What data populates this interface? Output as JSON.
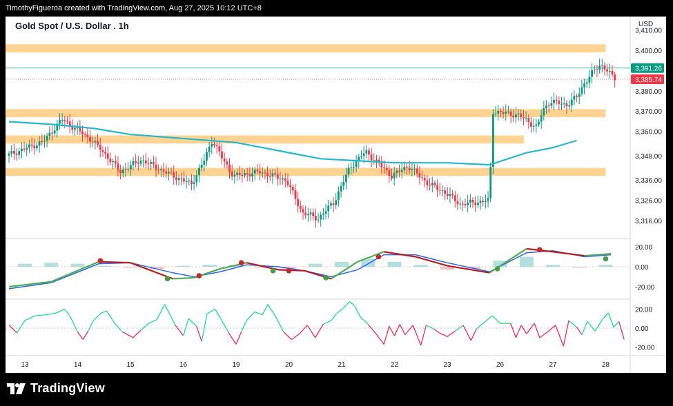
{
  "header": {
    "text": "TimothyFigueroa created with TradingView.com, Aug 27, 2025 10:12 UTC+8"
  },
  "footer": {
    "brand": "TradingView"
  },
  "colors": {
    "up": "#089981",
    "down": "#f23645",
    "zone": "#ffcc80",
    "ema": "#22b8cf",
    "lastPriceLine": "#089981",
    "prevCloseLine": "#f23645"
  },
  "chart_data": {
    "type": "candlestick",
    "title": "Gold Spot / U.S. Dollar . 1h",
    "currency": "USD",
    "x_labels": [
      "13",
      "14",
      "15",
      "16",
      "19",
      "20",
      "21",
      "22",
      "23",
      "26",
      "27",
      "28"
    ],
    "price_axis": {
      "ticks": [
        3316,
        3326,
        3336,
        3348,
        3360,
        3370,
        3380,
        3400,
        3410
      ],
      "tick_labels": [
        "3,316.00",
        "3,326.00",
        "3,336.00",
        "3,348.00",
        "3,360.00",
        "3,370.00",
        "3,380.00",
        "3,400.00",
        "3,410.00"
      ]
    },
    "last_price": {
      "value": 3391.26,
      "label": "3,391.26"
    },
    "prev_close": {
      "value": 3385.74,
      "label": "3,385.74"
    },
    "zones": [
      {
        "low": 3399,
        "high": 3403,
        "from_day": 0,
        "to_day": 11
      },
      {
        "low": 3367,
        "high": 3371,
        "from_day": 0,
        "to_day": 11
      },
      {
        "low": 3354,
        "high": 3358,
        "from_day": 0,
        "to_day": 9.45
      },
      {
        "low": 3338,
        "high": 3342,
        "from_day": 0,
        "to_day": 11
      }
    ],
    "ema": [
      [
        -0.3,
        3364.8
      ],
      [
        0.5,
        3363.5
      ],
      [
        1.3,
        3361.5
      ],
      [
        2.0,
        3358.5
      ],
      [
        3.0,
        3356.5
      ],
      [
        4.0,
        3354.5
      ],
      [
        5.0,
        3349.5
      ],
      [
        5.6,
        3346.5
      ],
      [
        6.3,
        3345.5
      ],
      [
        7.0,
        3344.5
      ],
      [
        8.0,
        3344.5
      ],
      [
        8.8,
        3343.5
      ],
      [
        9.5,
        3349.5
      ],
      [
        10.0,
        3352
      ],
      [
        10.45,
        3355.5
      ]
    ],
    "price_path": [
      [
        -0.3,
        3348
      ],
      [
        0.4,
        3355
      ],
      [
        0.75,
        3366
      ],
      [
        1.3,
        3356
      ],
      [
        1.6,
        3348
      ],
      [
        1.85,
        3340
      ],
      [
        2.25,
        3346
      ],
      [
        2.7,
        3340
      ],
      [
        3.2,
        3334
      ],
      [
        3.45,
        3346
      ],
      [
        3.6,
        3356
      ],
      [
        3.8,
        3346
      ],
      [
        4.0,
        3338
      ],
      [
        4.5,
        3340
      ],
      [
        5.0,
        3336
      ],
      [
        5.3,
        3320
      ],
      [
        5.6,
        3317
      ],
      [
        5.9,
        3325
      ],
      [
        6.2,
        3342
      ],
      [
        6.5,
        3350
      ],
      [
        7.0,
        3338
      ],
      [
        7.3,
        3343
      ],
      [
        7.7,
        3334
      ],
      [
        8.0,
        3330
      ],
      [
        8.3,
        3324
      ],
      [
        8.85,
        3326
      ],
      [
        8.9,
        3370
      ],
      [
        9.4,
        3368
      ],
      [
        9.75,
        3362
      ],
      [
        9.85,
        3370
      ],
      [
        10.0,
        3375
      ],
      [
        10.3,
        3373
      ],
      [
        10.5,
        3377
      ],
      [
        10.65,
        3384
      ],
      [
        10.8,
        3389
      ],
      [
        10.95,
        3393
      ],
      [
        11.05,
        3391
      ],
      [
        11.2,
        3386
      ]
    ],
    "macd": {
      "axis_labels": [
        "20.00",
        "0.00",
        "-20.00"
      ],
      "axis_values": [
        20,
        0,
        -20
      ],
      "macd_line": [
        [
          -0.3,
          -20
        ],
        [
          0.5,
          -15
        ],
        [
          1.4,
          5
        ],
        [
          2.0,
          4
        ],
        [
          2.8,
          -12
        ],
        [
          3.2,
          -11
        ],
        [
          3.7,
          -2
        ],
        [
          4.2,
          4
        ],
        [
          4.8,
          -3
        ],
        [
          5.3,
          -4
        ],
        [
          5.8,
          -12
        ],
        [
          6.3,
          5
        ],
        [
          6.8,
          15
        ],
        [
          7.4,
          10
        ],
        [
          8.0,
          1
        ],
        [
          8.8,
          -6
        ],
        [
          9.5,
          18
        ],
        [
          10.0,
          15
        ],
        [
          10.6,
          11
        ],
        [
          11.1,
          13
        ]
      ],
      "signal_line": [
        [
          -0.3,
          -22
        ],
        [
          0.5,
          -16
        ],
        [
          1.4,
          3
        ],
        [
          2.0,
          4
        ],
        [
          2.8,
          -6
        ],
        [
          3.2,
          -10
        ],
        [
          3.7,
          -5
        ],
        [
          4.2,
          2
        ],
        [
          4.8,
          0
        ],
        [
          5.3,
          -4
        ],
        [
          5.8,
          -10
        ],
        [
          6.3,
          -3
        ],
        [
          6.8,
          12
        ],
        [
          7.4,
          12
        ],
        [
          8.0,
          4
        ],
        [
          8.8,
          -5
        ],
        [
          9.5,
          14
        ],
        [
          10.0,
          16
        ],
        [
          10.6,
          10
        ],
        [
          11.1,
          12
        ]
      ],
      "histogram": [
        [
          0,
          3
        ],
        [
          0.5,
          4
        ],
        [
          1.0,
          3
        ],
        [
          1.5,
          1
        ],
        [
          2.0,
          -1
        ],
        [
          2.5,
          -2
        ],
        [
          3.0,
          1
        ],
        [
          3.5,
          2
        ],
        [
          4.0,
          2
        ],
        [
          4.5,
          -1
        ],
        [
          5.0,
          -2
        ],
        [
          5.5,
          3
        ],
        [
          6.0,
          5
        ],
        [
          6.5,
          8
        ],
        [
          7.0,
          5
        ],
        [
          7.5,
          2
        ],
        [
          8.0,
          -3
        ],
        [
          8.5,
          -2
        ],
        [
          9.0,
          6
        ],
        [
          9.5,
          10
        ],
        [
          10.0,
          2
        ],
        [
          10.5,
          -1
        ],
        [
          11.0,
          2
        ]
      ],
      "cross_points": [
        [
          1.43,
          6,
          "down"
        ],
        [
          2.7,
          -12,
          "up"
        ],
        [
          3.3,
          -9,
          "down"
        ],
        [
          4.1,
          4,
          "down"
        ],
        [
          4.7,
          -4,
          "up"
        ],
        [
          5.0,
          -4,
          "down"
        ],
        [
          5.7,
          -11,
          "up"
        ],
        [
          6.7,
          10,
          "down"
        ],
        [
          8.95,
          -2,
          "up"
        ],
        [
          9.75,
          17,
          "down"
        ],
        [
          11.0,
          8,
          "up"
        ]
      ]
    },
    "oscillator": {
      "axis_labels": [
        "20.00",
        "0.00",
        "-20.00"
      ],
      "axis_values": [
        20,
        0,
        -20
      ],
      "series": [
        [
          -0.3,
          3
        ],
        [
          -0.15,
          -5
        ],
        [
          0,
          8
        ],
        [
          0.2,
          13
        ],
        [
          0.4,
          14
        ],
        [
          0.6,
          16
        ],
        [
          0.75,
          20
        ],
        [
          0.85,
          13
        ],
        [
          1.0,
          -4
        ],
        [
          1.1,
          -12
        ],
        [
          1.2,
          -3
        ],
        [
          1.3,
          8
        ],
        [
          1.45,
          16
        ],
        [
          1.55,
          18
        ],
        [
          1.7,
          5
        ],
        [
          1.85,
          -4
        ],
        [
          2.05,
          -10
        ],
        [
          2.2,
          -2
        ],
        [
          2.35,
          5
        ],
        [
          2.5,
          9
        ],
        [
          2.65,
          25
        ],
        [
          2.75,
          14
        ],
        [
          2.85,
          3
        ],
        [
          3.0,
          -8
        ],
        [
          3.1,
          10
        ],
        [
          3.25,
          2
        ],
        [
          3.35,
          -14
        ],
        [
          3.45,
          15
        ],
        [
          3.6,
          20
        ],
        [
          3.75,
          6
        ],
        [
          3.85,
          -4
        ],
        [
          4.0,
          -17
        ],
        [
          4.1,
          -4
        ],
        [
          4.2,
          8
        ],
        [
          4.35,
          17
        ],
        [
          4.5,
          14
        ],
        [
          4.6,
          25
        ],
        [
          4.75,
          12
        ],
        [
          4.9,
          -4
        ],
        [
          5.05,
          -12
        ],
        [
          5.2,
          -6
        ],
        [
          5.35,
          3
        ],
        [
          5.5,
          -10
        ],
        [
          5.65,
          4
        ],
        [
          5.8,
          8
        ],
        [
          5.9,
          15
        ],
        [
          6.05,
          22
        ],
        [
          6.15,
          28
        ],
        [
          6.25,
          23
        ],
        [
          6.35,
          12
        ],
        [
          6.5,
          4
        ],
        [
          6.65,
          -6
        ],
        [
          6.8,
          -17
        ],
        [
          6.9,
          2
        ],
        [
          7.0,
          -8
        ],
        [
          7.1,
          4
        ],
        [
          7.2,
          -7
        ],
        [
          7.35,
          3
        ],
        [
          7.5,
          -18
        ],
        [
          7.6,
          3
        ],
        [
          7.75,
          -1
        ],
        [
          7.85,
          -5
        ],
        [
          8.0,
          -9
        ],
        [
          8.15,
          -3
        ],
        [
          8.3,
          3
        ],
        [
          8.45,
          -13
        ],
        [
          8.55,
          -1
        ],
        [
          8.7,
          6
        ],
        [
          8.85,
          13
        ],
        [
          9.0,
          5
        ],
        [
          9.2,
          5
        ],
        [
          9.3,
          -10
        ],
        [
          9.4,
          3
        ],
        [
          9.5,
          -6
        ],
        [
          9.65,
          5
        ],
        [
          9.75,
          -10
        ],
        [
          9.9,
          -4
        ],
        [
          10.05,
          3
        ],
        [
          10.2,
          -19
        ],
        [
          10.3,
          8
        ],
        [
          10.45,
          1
        ],
        [
          10.55,
          -7
        ],
        [
          10.65,
          7
        ],
        [
          10.8,
          -3
        ],
        [
          10.95,
          10
        ],
        [
          11.05,
          16
        ],
        [
          11.15,
          1
        ],
        [
          11.25,
          7
        ],
        [
          11.35,
          -12
        ]
      ]
    }
  }
}
